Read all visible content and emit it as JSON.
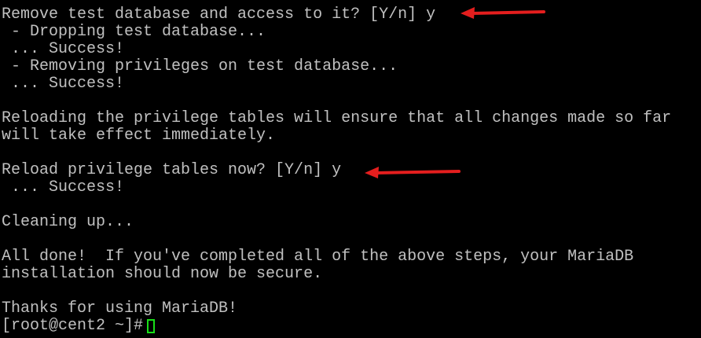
{
  "colors": {
    "background": "#000000",
    "text": "#c0c0c0",
    "cursor": "#18e018",
    "annotation_arrow": "#e41e1e"
  },
  "terminal": {
    "lines": [
      "Remove test database and access to it? [Y/n] y",
      " - Dropping test database...",
      " ... Success!",
      " - Removing privileges on test database...",
      " ... Success!",
      "",
      "Reloading the privilege tables will ensure that all changes made so far",
      "will take effect immediately.",
      "",
      "Reload privilege tables now? [Y/n] y",
      " ... Success!",
      "",
      "Cleaning up...",
      "",
      "All done!  If you've completed all of the above steps, your MariaDB",
      "installation should now be secure.",
      "",
      "Thanks for using MariaDB!"
    ],
    "prompt": "[root@cent2 ~]#"
  },
  "annotations": {
    "arrow_icons": [
      "left-arrow-icon",
      "left-arrow-icon"
    ]
  }
}
